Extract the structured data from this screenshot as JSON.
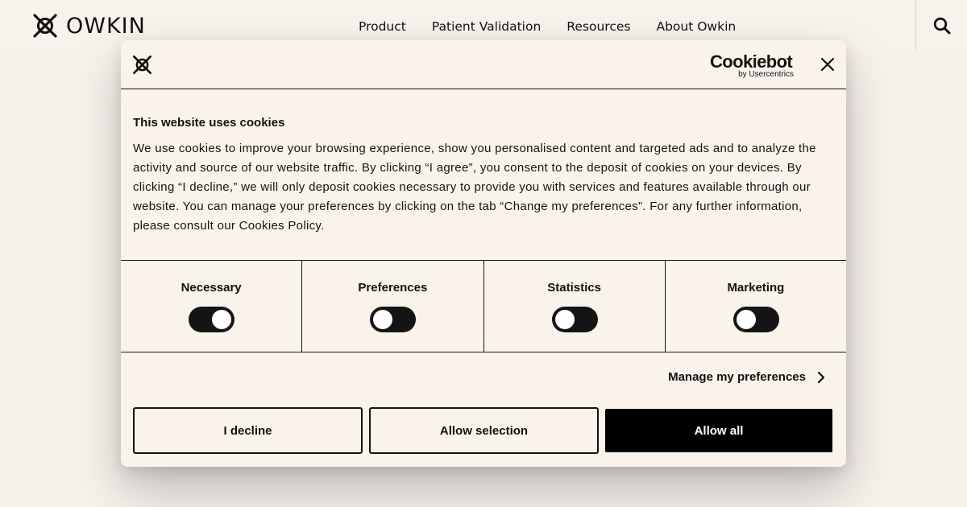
{
  "header": {
    "brand": "OWKIN",
    "nav": [
      "Product",
      "Patient Validation",
      "Resources",
      "About Owkin"
    ]
  },
  "icons": {
    "logo": "owkin-logo-icon",
    "search": "search-icon",
    "close": "close-icon",
    "chevron": "chevron-right-icon"
  },
  "cookie_dialog": {
    "provider_name": "Cookiebot",
    "provider_sub": "by Usercentrics",
    "title": "This website uses cookies",
    "body": "We use cookies to improve your browsing experience, show you personalised content and targeted ads and to analyze the activity and source of our website traffic. By clicking “I agree”, you consent to the deposit of cookies on your devices. By clicking “I decline,” we will only deposit cookies necessary to provide you with services and features available through our website. You can manage your preferences by clicking on the tab “Change my preferences”. For any further information, please consult our Cookies Policy.",
    "categories": [
      {
        "label": "Necessary",
        "enabled": true
      },
      {
        "label": "Preferences",
        "enabled": false
      },
      {
        "label": "Statistics",
        "enabled": false
      },
      {
        "label": "Marketing",
        "enabled": false
      }
    ],
    "manage_label": "Manage my preferences",
    "buttons": {
      "decline": "I decline",
      "selection": "Allow selection",
      "all": "Allow all"
    }
  },
  "colors": {
    "background": "#f6f1eb",
    "dialog": "#f9f3ec",
    "ink": "#141414",
    "accent_button": "#000000"
  }
}
